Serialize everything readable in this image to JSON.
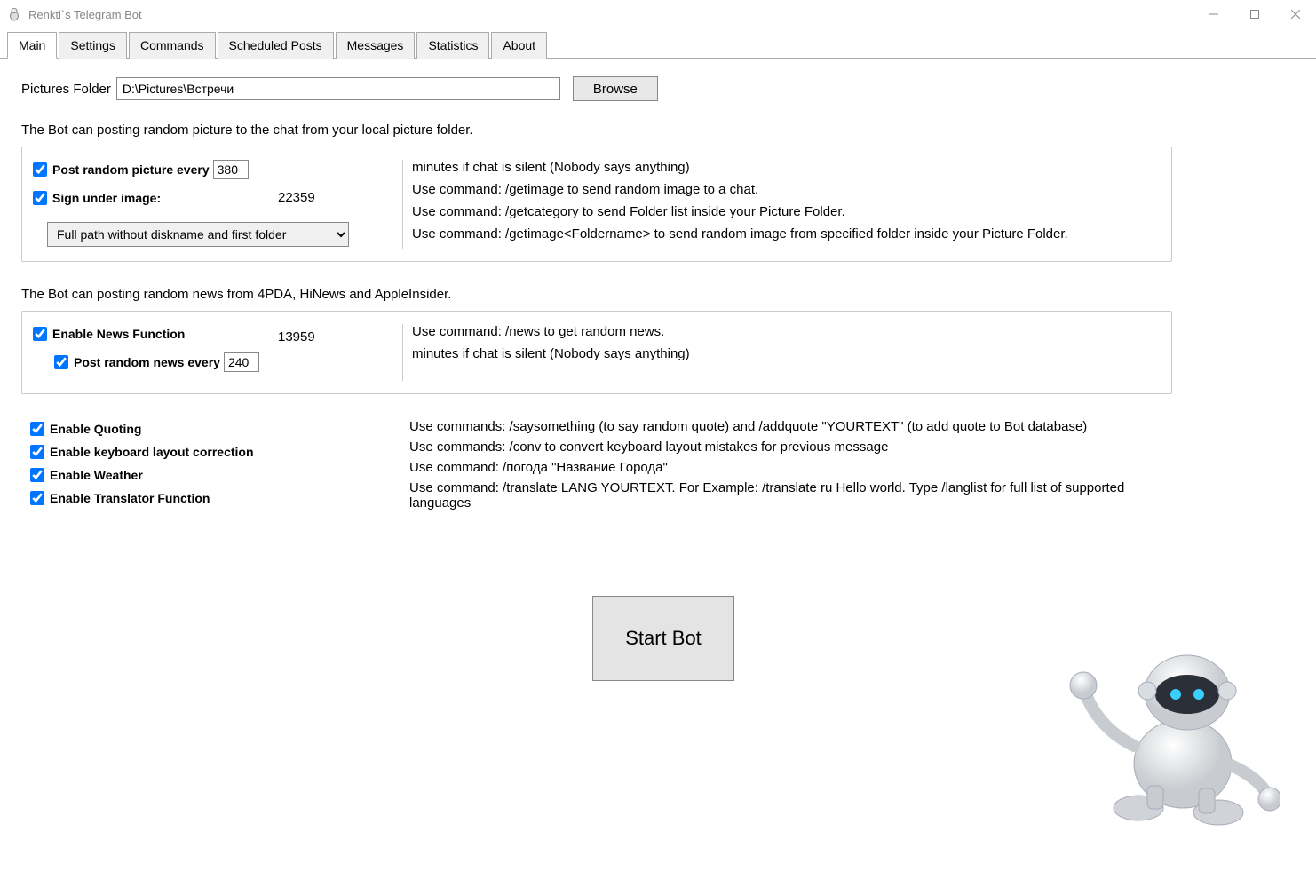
{
  "window": {
    "title": "Renkti`s Telegram Bot"
  },
  "tabs": [
    "Main",
    "Settings",
    "Commands",
    "Scheduled Posts",
    "Messages",
    "Statistics",
    "About"
  ],
  "activeTab": "Main",
  "picturesFolder": {
    "label": "Pictures Folder",
    "value": "D:\\Pictures\\Встречи",
    "browse": "Browse"
  },
  "pictureGroup": {
    "title": "The Bot can posting random picture to the chat from your local picture folder.",
    "postRandomLabel": "Post random picture every",
    "postRandomValue": "380",
    "signLabel": "Sign under image:",
    "countBadge": "22359",
    "comboSelected": "Full path without diskname and first folder",
    "help1": "minutes if chat is silent (Nobody says anything)",
    "help2": "Use command: /getimage to send random image to a chat.",
    "help3": "Use command: /getcategory to send Folder list inside your Picture Folder.",
    "help4": "Use command: /getimage<Foldername> to send random image from specified folder inside your Picture Folder."
  },
  "newsGroup": {
    "title": "The Bot can posting random news from 4PDA, HiNews and AppleInsider.",
    "enableLabel": "Enable News Function",
    "postLabel": "Post random news every",
    "postValue": "240",
    "countBadge": "13959",
    "help1": "Use command: /news to get random news.",
    "help2": "minutes if chat is silent (Nobody says anything)"
  },
  "features": {
    "quoting": {
      "label": "Enable Quoting",
      "help": "Use commands: /saysomething (to say random quote) and /addquote \"YOURTEXT\" (to add quote to Bot database)"
    },
    "layout": {
      "label": "Enable keyboard layout correction",
      "help": "Use commands: /conv to convert keyboard layout mistakes for previous message"
    },
    "weather": {
      "label": "Enable Weather",
      "help": "Use command: /погода \"Название Города\""
    },
    "translator": {
      "label": "Enable Translator Function",
      "help": "Use command: /translate LANG YOURTEXT. For Example: /translate ru Hello world. Type /langlist for full list of supported languages"
    }
  },
  "startButton": "Start Bot"
}
